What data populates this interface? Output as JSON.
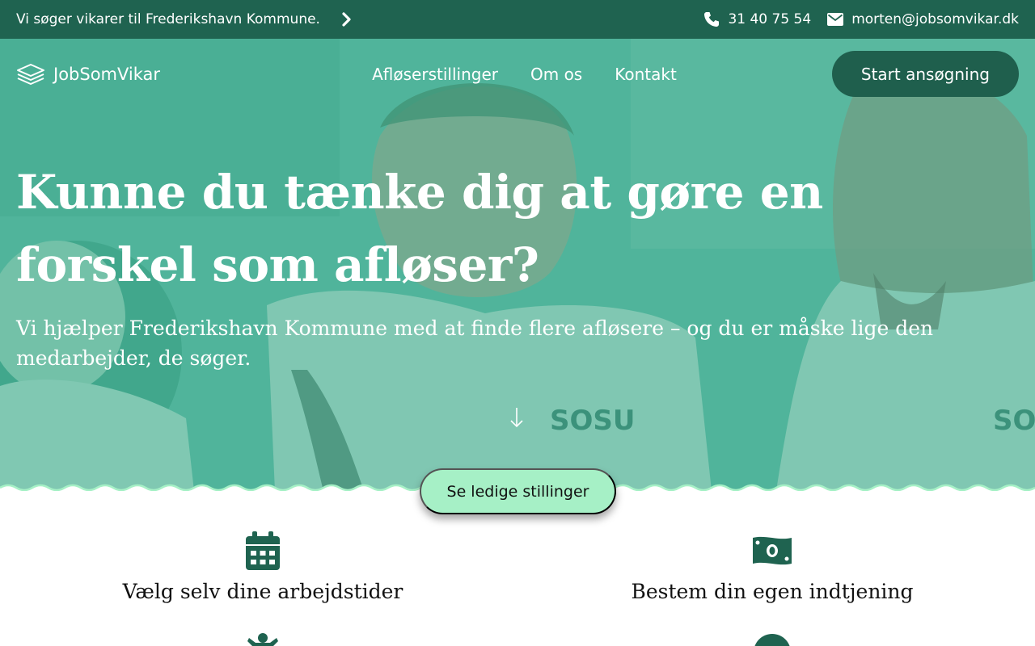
{
  "topbar": {
    "announcement": "Vi søger vikarer til Frederikshavn Kommune.",
    "phone": "31 40 75 54",
    "email": "morten@jobsomvikar.dk"
  },
  "nav": {
    "logo": "JobSomVikar",
    "links": [
      "Afløserstillinger",
      "Om os",
      "Kontakt"
    ],
    "cta": "Start ansøgning"
  },
  "hero": {
    "title": "Kunne du tænke dig at gøre en forskel som afløser?",
    "subtitle": "Vi hjælper Frederikshavn Kommune med at finde flere afløsere – og du er måske lige den medarbejder, de søger.",
    "photo_text": "SOSU",
    "cta": "Se ledige stillinger"
  },
  "features": [
    {
      "icon": "calendar-icon",
      "title": "Vælg selv dine arbejdstider"
    },
    {
      "icon": "money-bill-icon",
      "title": "Bestem din egen indtjening"
    }
  ],
  "colors": {
    "dark_green": "#1f6350",
    "button_dark": "#1f5f4d",
    "mint": "#a6f0c6",
    "hero_overlay": "#3aaa8c"
  }
}
